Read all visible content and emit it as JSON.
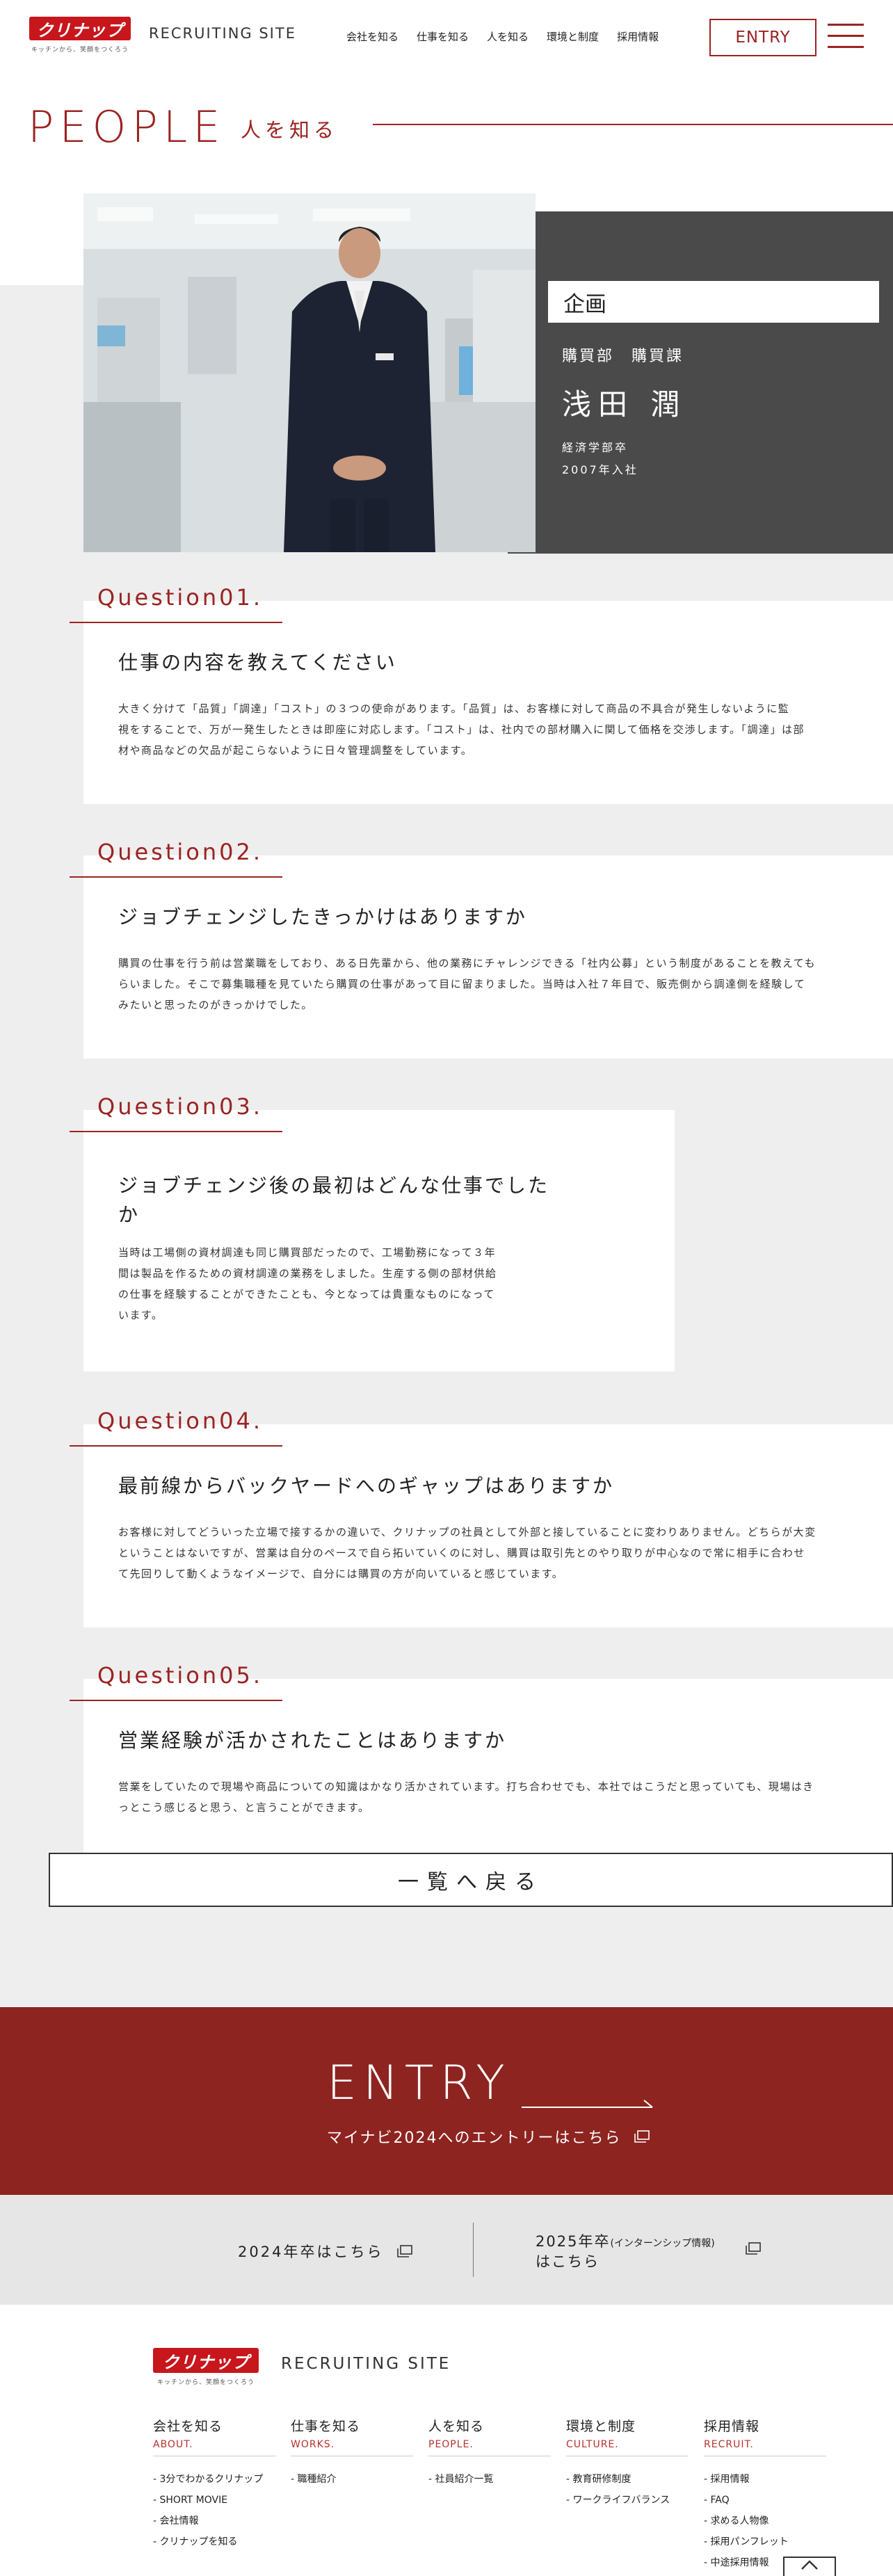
{
  "header": {
    "logo_text": "クリナップ",
    "logo_tagline": "キッチンから、笑顔をつくろう",
    "site_name": "RECRUITING SITE",
    "nav": [
      "会社を知る",
      "仕事を知る",
      "人を知る",
      "環境と制度",
      "採用情報"
    ],
    "entry_label": "ENTRY",
    "menu_icon": "hamburger-icon"
  },
  "page": {
    "title": "PEOPLE",
    "subtitle": "人を知る"
  },
  "profile": {
    "job": "企画",
    "department": "購買部　購買課",
    "name": "浅田 潤",
    "education": "経済学部卒",
    "joined": "2007年入社"
  },
  "questions": [
    {
      "label": "Question01.",
      "title": "仕事の内容を教えてください",
      "lines": [
        "大きく分けて「品質」「調達」「コスト」の３つの使命があります。「品質」は、お客様に対して商品の不具合が発生しないように監",
        "視をすることで、万が一発生したときは即座に対応します。「コスト」は、社内での部材購入に関して価格を交渉します。「調達」は部",
        "材や商品などの欠品が起こらないように日々管理調整をしています。"
      ]
    },
    {
      "label": "Question02.",
      "title": "ジョブチェンジしたきっかけはありますか",
      "lines": [
        "購買の仕事を行う前は営業職をしており、ある日先輩から、他の業務にチャレンジできる「社内公募」という制度があることを教えても",
        "らいました。そこで募集職種を見ていたら購買の仕事があって目に留まりました。当時は入社７年目で、販売側から調達側を経験して",
        "みたいと思ったのがきっかけでした。"
      ]
    },
    {
      "label": "Question03.",
      "title_lines": [
        "ジョブチェンジ後の最初はどんな仕事でした",
        "か"
      ],
      "lines": [
        "当時は工場側の資材調達も同じ購買部だったので、工場勤務になって３年",
        "間は製品を作るための資材調達の業務をしました。生産する側の部材供給",
        "の仕事を経験することができたことも、今となっては貴重なものになって",
        "います。"
      ]
    },
    {
      "label": "Question04.",
      "title": "最前線からバックヤードへのギャップはありますか",
      "lines": [
        "お客様に対してどういった立場で接するかの違いで、クリナップの社員として外部と接していることに変わりありません。どちらが大変",
        "ということはないですが、営業は自分のペースで自ら拓いていくのに対し、購買は取引先とのやり取りが中心なので常に相手に合わせ",
        "て先回りして動くようなイメージで、自分には購買の方が向いていると感じています。"
      ]
    },
    {
      "label": "Question05.",
      "title": "営業経験が活かされたことはありますか",
      "lines": [
        "営業をしていたので現場や商品についての知識はかなり活かされています。打ち合わせでも、本社ではこうだと思っていても、現場はき",
        "っとこう感じると思う、と言うことができます。"
      ]
    }
  ],
  "back_label": "一覧へ戻る",
  "entry_band": {
    "big": "ENTRY",
    "sub": "マイナビ2024へのエントリーはこちら"
  },
  "years": {
    "y2024": "2024年卒はこちら",
    "y2025_a": "2025年卒",
    "y2025_note": "(インターンシップ情報)",
    "y2025_b": "はこちら"
  },
  "footer": {
    "site_name": "RECRUITING SITE",
    "columns": [
      {
        "title": "会社を知る",
        "en": "ABOUT.",
        "items": [
          "3分でわかるクリナップ",
          "SHORT MOVIE",
          "会社情報",
          "クリナップを知る"
        ]
      },
      {
        "title": "仕事を知る",
        "en": "WORKS.",
        "items": [
          "職種紹介"
        ]
      },
      {
        "title": "人を知る",
        "en": "PEOPLE.",
        "items": [
          "社員紹介一覧"
        ]
      },
      {
        "title": "環境と制度",
        "en": "CULTURE.",
        "items": [
          "教育研修制度",
          "ワークライフバランス"
        ]
      },
      {
        "title": "採用情報",
        "en": "RECRUIT.",
        "items": [
          "採用情報",
          "FAQ",
          "求める人物像",
          "採用パンフレット",
          "中途採用情報"
        ]
      }
    ]
  },
  "colors": {
    "brand_red": "#c8161d",
    "accent": "#9b2322",
    "entry_band": "#8e2420",
    "panel": "#4a4a4a",
    "gray_bg": "#eeeeee"
  }
}
